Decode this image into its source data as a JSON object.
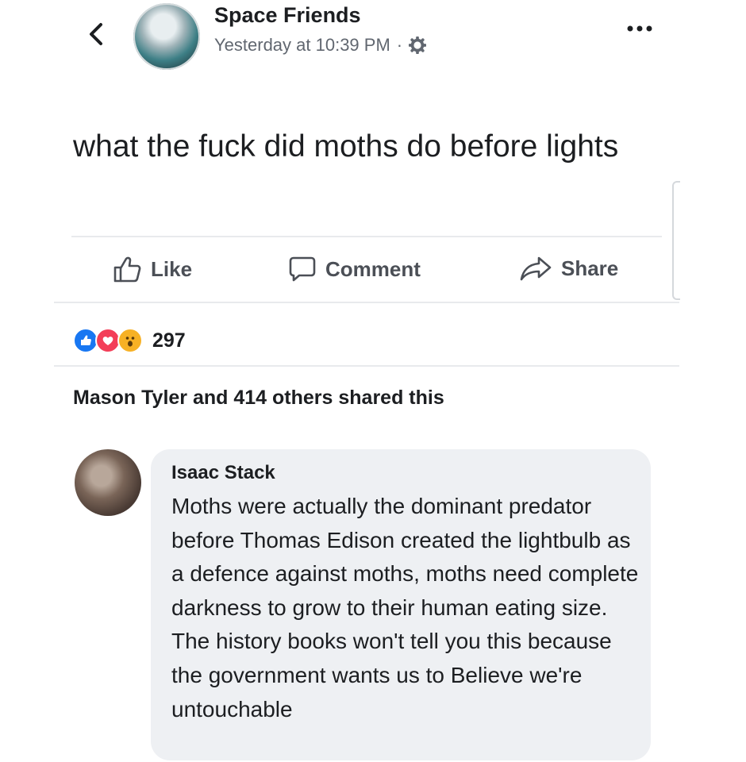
{
  "post": {
    "page_name": "Space Friends",
    "timestamp": "Yesterday at 10:39 PM",
    "separator": "·",
    "privacy_icon": "gear-icon",
    "text": "what the fuck did moths do before lights"
  },
  "actions": {
    "like_label": "Like",
    "comment_label": "Comment",
    "share_label": "Share"
  },
  "reactions": {
    "types": [
      "like",
      "love",
      "wow"
    ],
    "count": "297"
  },
  "shares": {
    "text": "Mason Tyler and 414 others shared this"
  },
  "comment": {
    "author": "Isaac Stack",
    "text": "Moths were actually the dominant predator before Thomas Edison created the lightbulb as a defence against moths, moths need complete darkness to grow to their human eating size. The history books won't tell you this because the government wants us to Believe we're untouchable"
  },
  "colors": {
    "like_blue": "#1877f2",
    "love_red": "#f33e58",
    "wow_yellow": "#f7b125",
    "comment_bubble": "#eef0f3",
    "secondary_text": "#616770"
  }
}
